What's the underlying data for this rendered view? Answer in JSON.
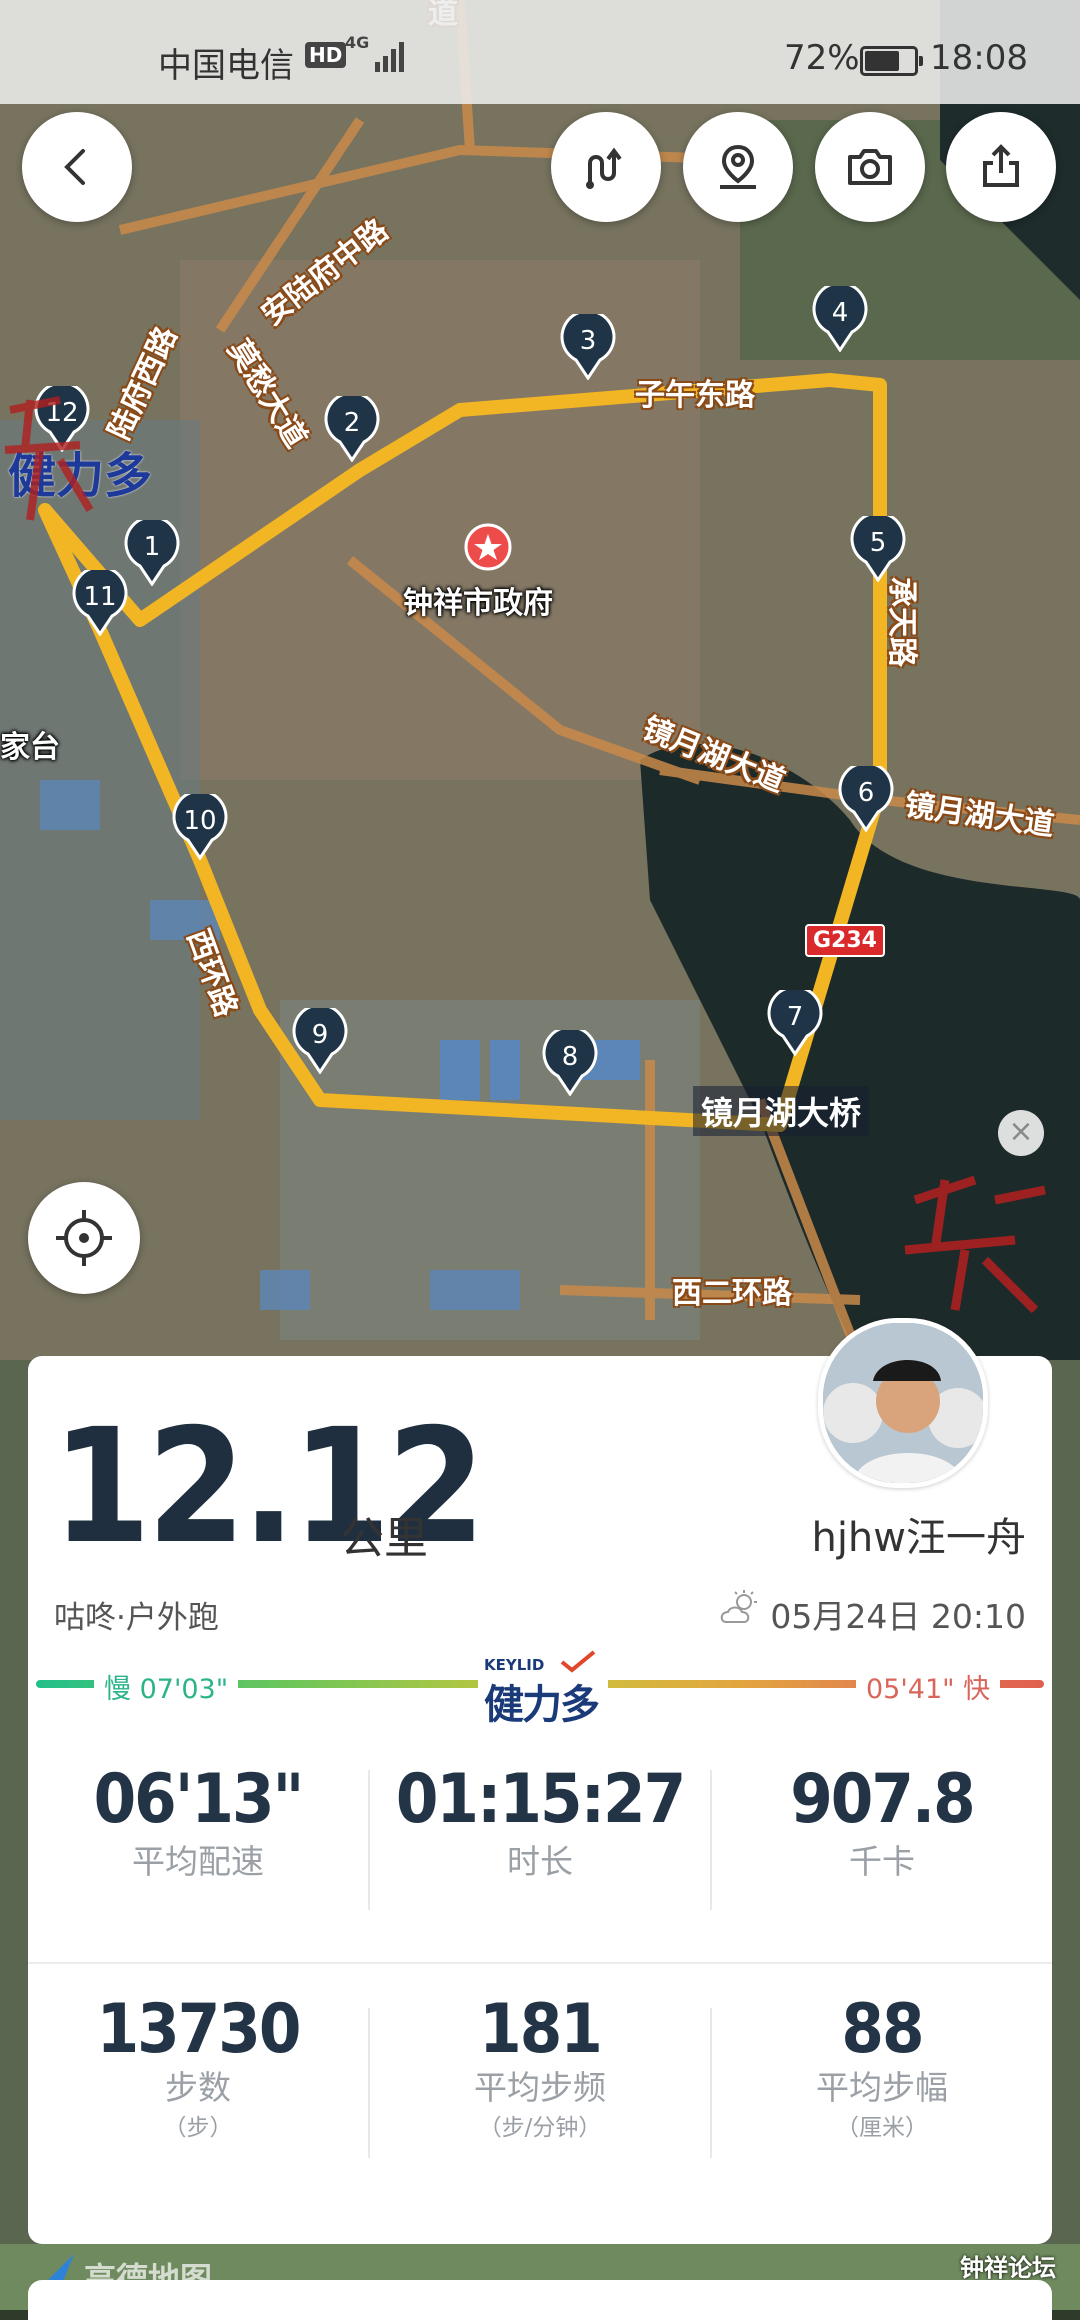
{
  "status_bar": {
    "carrier": "中国电信",
    "hd": "HD",
    "network": "4G",
    "battery_percent": "72%",
    "time": "18:08"
  },
  "toolbar": {
    "back": "back-icon",
    "route": "route-icon",
    "location": "location-pin-icon",
    "camera": "camera-icon",
    "share": "share-icon"
  },
  "map": {
    "poi": "钟祥市政府",
    "roads": [
      "安陆府中路",
      "陆府西路",
      "莫愁大道",
      "子午东路",
      "承天路",
      "镜月湖大道",
      "镜月湖大道",
      "西环路",
      "西二环路",
      "道"
    ],
    "places": [
      "家台"
    ],
    "road_shield": "G234",
    "bridge": "镜月湖大桥",
    "km_markers": [
      "1",
      "2",
      "3",
      "4",
      "5",
      "6",
      "7",
      "8",
      "9",
      "10",
      "11",
      "12"
    ],
    "watermark_brand": "健力多",
    "route_color": "#f2b523"
  },
  "summary": {
    "distance": "12.12",
    "unit": "公里",
    "username": "hjhw汪一舟",
    "activity": "咕咚·户外跑",
    "datetime": "05月24日 20:10",
    "pace_slow": "慢 07'03\"",
    "pace_fast": "05'41\" 快",
    "brand_en": "KEYLID",
    "brand_cn": "健力多"
  },
  "stats": [
    {
      "value": "06'13\"",
      "label": "平均配速",
      "sub": ""
    },
    {
      "value": "01:15:27",
      "label": "时长",
      "sub": ""
    },
    {
      "value": "907.8",
      "label": "千卡",
      "sub": ""
    },
    {
      "value": "13730",
      "label": "步数",
      "sub": "（步）"
    },
    {
      "value": "181",
      "label": "平均步频",
      "sub": "（步/分钟）"
    },
    {
      "value": "88",
      "label": "平均步幅",
      "sub": "（厘米）"
    }
  ],
  "footer": {
    "map_provider": "高德地图",
    "forum": "钟祥论坛"
  }
}
